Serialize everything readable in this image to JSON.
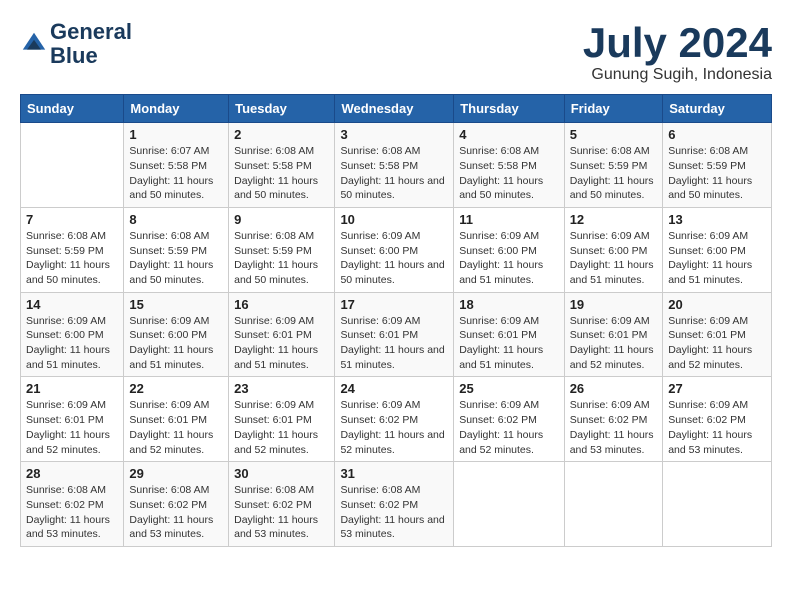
{
  "logo": {
    "line1": "General",
    "line2": "Blue"
  },
  "title": "July 2024",
  "subtitle": "Gunung Sugih, Indonesia",
  "weekdays": [
    "Sunday",
    "Monday",
    "Tuesday",
    "Wednesday",
    "Thursday",
    "Friday",
    "Saturday"
  ],
  "weeks": [
    [
      {
        "day": "",
        "sunrise": "",
        "sunset": "",
        "daylight": ""
      },
      {
        "day": "1",
        "sunrise": "Sunrise: 6:07 AM",
        "sunset": "Sunset: 5:58 PM",
        "daylight": "Daylight: 11 hours and 50 minutes."
      },
      {
        "day": "2",
        "sunrise": "Sunrise: 6:08 AM",
        "sunset": "Sunset: 5:58 PM",
        "daylight": "Daylight: 11 hours and 50 minutes."
      },
      {
        "day": "3",
        "sunrise": "Sunrise: 6:08 AM",
        "sunset": "Sunset: 5:58 PM",
        "daylight": "Daylight: 11 hours and 50 minutes."
      },
      {
        "day": "4",
        "sunrise": "Sunrise: 6:08 AM",
        "sunset": "Sunset: 5:58 PM",
        "daylight": "Daylight: 11 hours and 50 minutes."
      },
      {
        "day": "5",
        "sunrise": "Sunrise: 6:08 AM",
        "sunset": "Sunset: 5:59 PM",
        "daylight": "Daylight: 11 hours and 50 minutes."
      },
      {
        "day": "6",
        "sunrise": "Sunrise: 6:08 AM",
        "sunset": "Sunset: 5:59 PM",
        "daylight": "Daylight: 11 hours and 50 minutes."
      }
    ],
    [
      {
        "day": "7",
        "sunrise": "Sunrise: 6:08 AM",
        "sunset": "Sunset: 5:59 PM",
        "daylight": "Daylight: 11 hours and 50 minutes."
      },
      {
        "day": "8",
        "sunrise": "Sunrise: 6:08 AM",
        "sunset": "Sunset: 5:59 PM",
        "daylight": "Daylight: 11 hours and 50 minutes."
      },
      {
        "day": "9",
        "sunrise": "Sunrise: 6:08 AM",
        "sunset": "Sunset: 5:59 PM",
        "daylight": "Daylight: 11 hours and 50 minutes."
      },
      {
        "day": "10",
        "sunrise": "Sunrise: 6:09 AM",
        "sunset": "Sunset: 6:00 PM",
        "daylight": "Daylight: 11 hours and 50 minutes."
      },
      {
        "day": "11",
        "sunrise": "Sunrise: 6:09 AM",
        "sunset": "Sunset: 6:00 PM",
        "daylight": "Daylight: 11 hours and 51 minutes."
      },
      {
        "day": "12",
        "sunrise": "Sunrise: 6:09 AM",
        "sunset": "Sunset: 6:00 PM",
        "daylight": "Daylight: 11 hours and 51 minutes."
      },
      {
        "day": "13",
        "sunrise": "Sunrise: 6:09 AM",
        "sunset": "Sunset: 6:00 PM",
        "daylight": "Daylight: 11 hours and 51 minutes."
      }
    ],
    [
      {
        "day": "14",
        "sunrise": "Sunrise: 6:09 AM",
        "sunset": "Sunset: 6:00 PM",
        "daylight": "Daylight: 11 hours and 51 minutes."
      },
      {
        "day": "15",
        "sunrise": "Sunrise: 6:09 AM",
        "sunset": "Sunset: 6:00 PM",
        "daylight": "Daylight: 11 hours and 51 minutes."
      },
      {
        "day": "16",
        "sunrise": "Sunrise: 6:09 AM",
        "sunset": "Sunset: 6:01 PM",
        "daylight": "Daylight: 11 hours and 51 minutes."
      },
      {
        "day": "17",
        "sunrise": "Sunrise: 6:09 AM",
        "sunset": "Sunset: 6:01 PM",
        "daylight": "Daylight: 11 hours and 51 minutes."
      },
      {
        "day": "18",
        "sunrise": "Sunrise: 6:09 AM",
        "sunset": "Sunset: 6:01 PM",
        "daylight": "Daylight: 11 hours and 51 minutes."
      },
      {
        "day": "19",
        "sunrise": "Sunrise: 6:09 AM",
        "sunset": "Sunset: 6:01 PM",
        "daylight": "Daylight: 11 hours and 52 minutes."
      },
      {
        "day": "20",
        "sunrise": "Sunrise: 6:09 AM",
        "sunset": "Sunset: 6:01 PM",
        "daylight": "Daylight: 11 hours and 52 minutes."
      }
    ],
    [
      {
        "day": "21",
        "sunrise": "Sunrise: 6:09 AM",
        "sunset": "Sunset: 6:01 PM",
        "daylight": "Daylight: 11 hours and 52 minutes."
      },
      {
        "day": "22",
        "sunrise": "Sunrise: 6:09 AM",
        "sunset": "Sunset: 6:01 PM",
        "daylight": "Daylight: 11 hours and 52 minutes."
      },
      {
        "day": "23",
        "sunrise": "Sunrise: 6:09 AM",
        "sunset": "Sunset: 6:01 PM",
        "daylight": "Daylight: 11 hours and 52 minutes."
      },
      {
        "day": "24",
        "sunrise": "Sunrise: 6:09 AM",
        "sunset": "Sunset: 6:02 PM",
        "daylight": "Daylight: 11 hours and 52 minutes."
      },
      {
        "day": "25",
        "sunrise": "Sunrise: 6:09 AM",
        "sunset": "Sunset: 6:02 PM",
        "daylight": "Daylight: 11 hours and 52 minutes."
      },
      {
        "day": "26",
        "sunrise": "Sunrise: 6:09 AM",
        "sunset": "Sunset: 6:02 PM",
        "daylight": "Daylight: 11 hours and 53 minutes."
      },
      {
        "day": "27",
        "sunrise": "Sunrise: 6:09 AM",
        "sunset": "Sunset: 6:02 PM",
        "daylight": "Daylight: 11 hours and 53 minutes."
      }
    ],
    [
      {
        "day": "28",
        "sunrise": "Sunrise: 6:08 AM",
        "sunset": "Sunset: 6:02 PM",
        "daylight": "Daylight: 11 hours and 53 minutes."
      },
      {
        "day": "29",
        "sunrise": "Sunrise: 6:08 AM",
        "sunset": "Sunset: 6:02 PM",
        "daylight": "Daylight: 11 hours and 53 minutes."
      },
      {
        "day": "30",
        "sunrise": "Sunrise: 6:08 AM",
        "sunset": "Sunset: 6:02 PM",
        "daylight": "Daylight: 11 hours and 53 minutes."
      },
      {
        "day": "31",
        "sunrise": "Sunrise: 6:08 AM",
        "sunset": "Sunset: 6:02 PM",
        "daylight": "Daylight: 11 hours and 53 minutes."
      },
      {
        "day": "",
        "sunrise": "",
        "sunset": "",
        "daylight": ""
      },
      {
        "day": "",
        "sunrise": "",
        "sunset": "",
        "daylight": ""
      },
      {
        "day": "",
        "sunrise": "",
        "sunset": "",
        "daylight": ""
      }
    ]
  ]
}
